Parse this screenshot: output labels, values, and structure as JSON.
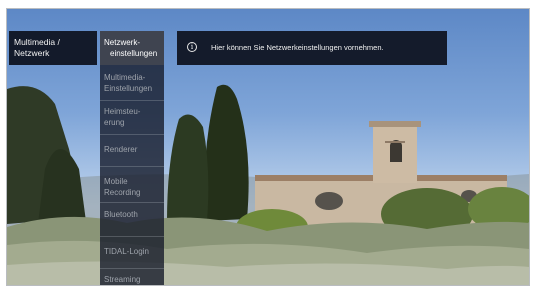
{
  "breadcrumb": {
    "line1": "Multimedia /",
    "line2": "Netzwerk"
  },
  "menu": {
    "items": [
      {
        "line1": "Netzwerk-",
        "line2": "einstellungen",
        "active": true
      },
      {
        "line1": "Multimedia-",
        "line2": "Einstellungen",
        "active": false
      },
      {
        "line1": "Heimsteu-",
        "line2": "erung",
        "active": false
      },
      {
        "line1": "Renderer",
        "line2": "",
        "active": false
      },
      {
        "line1": "Mobile",
        "line2": "Recording",
        "active": false
      },
      {
        "line1": "Bluetooth",
        "line2": "",
        "active": false
      },
      {
        "line1": "TIDAL-Login",
        "line2": "",
        "active": false
      },
      {
        "line1": "Streaming",
        "line2": "",
        "active": false
      }
    ]
  },
  "info": {
    "icon": "info-icon",
    "text": "Hier können Sie Netzwerkeinstellungen vornehmen."
  },
  "colors": {
    "panel": "#141b2b",
    "active_item": "#3f4450",
    "inactive_text": "#9ea3ab"
  }
}
